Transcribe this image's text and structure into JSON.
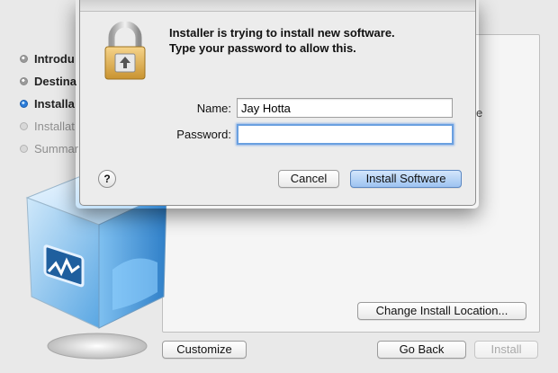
{
  "installer": {
    "steps": [
      {
        "label": "Introdu",
        "state": "done"
      },
      {
        "label": "Destina",
        "state": "done"
      },
      {
        "label": "Installa",
        "state": "active"
      },
      {
        "label": "Installat",
        "state": "pending"
      },
      {
        "label": "Summar",
        "state": "pending"
      }
    ],
    "edge_char": "e",
    "change_location_label": "Change Install Location...",
    "customize_label": "Customize",
    "go_back_label": "Go Back",
    "install_label": "Install"
  },
  "auth_dialog": {
    "message_line1": "Installer is trying to install new software.",
    "message_line2": "Type your password to allow this.",
    "name_label": "Name:",
    "name_value": "Jay Hotta",
    "password_label": "Password:",
    "password_value": "",
    "help_label": "?",
    "cancel_label": "Cancel",
    "install_software_label": "Install Software",
    "lock_icon": "padlock-icon"
  },
  "colors": {
    "default_button": "#9dc3f1",
    "focus_ring": "#6aa0e0",
    "active_step": "#2a7bd8"
  }
}
